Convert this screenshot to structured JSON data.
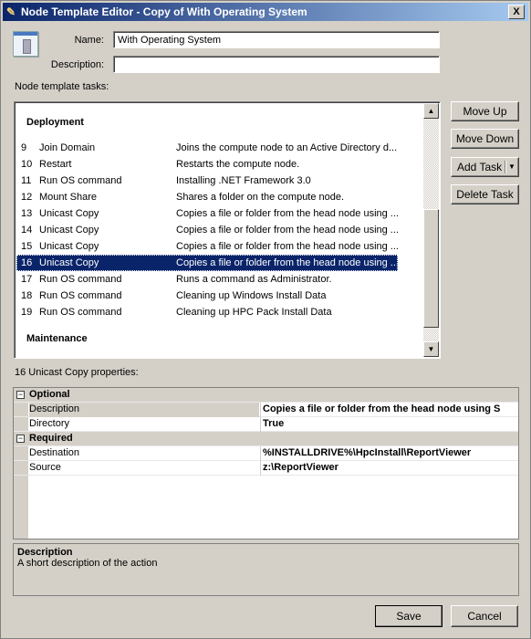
{
  "window": {
    "title": "Node Template Editor - Copy of With Operating System",
    "close_label": "X"
  },
  "form": {
    "name_label": "Name:",
    "name_value": "With Operating System",
    "description_label": "Description:",
    "description_value": ""
  },
  "tasks": {
    "label": "Node template tasks:",
    "groups": [
      "Deployment",
      "Maintenance"
    ],
    "rows": [
      {
        "num": "9",
        "name": "Join Domain",
        "desc": "Joins the compute node to an Active Directory d..."
      },
      {
        "num": "10",
        "name": "Restart",
        "desc": "Restarts the compute node."
      },
      {
        "num": "11",
        "name": "Run OS command",
        "desc": "Installing .NET Framework 3.0"
      },
      {
        "num": "12",
        "name": "Mount Share",
        "desc": "Shares a folder on the compute node."
      },
      {
        "num": "13",
        "name": "Unicast Copy",
        "desc": "Copies a file or folder from the head node using ..."
      },
      {
        "num": "14",
        "name": "Unicast Copy",
        "desc": "Copies a file or folder from the head node using ..."
      },
      {
        "num": "15",
        "name": "Unicast Copy",
        "desc": "Copies a file or folder from the head node using ..."
      },
      {
        "num": "16",
        "name": "Unicast Copy",
        "desc": "Copies a file or folder from the head node using ...",
        "selected": true
      },
      {
        "num": "17",
        "name": "Run OS command",
        "desc": "Runs a command as Administrator."
      },
      {
        "num": "18",
        "name": "Run OS command",
        "desc": "Cleaning up Windows Install Data"
      },
      {
        "num": "19",
        "name": "Run OS command",
        "desc": "Cleaning up HPC Pack Install Data"
      }
    ]
  },
  "buttons": {
    "move_up": "Move Up",
    "move_down": "Move Down",
    "add_task": "Add Task",
    "delete_task": "Delete Task",
    "save": "Save",
    "cancel": "Cancel"
  },
  "properties": {
    "label": "16 Unicast Copy properties:",
    "categories": [
      {
        "name": "Optional",
        "items": [
          {
            "key": "Description",
            "value": "Copies a file or folder from the head node using S",
            "selected": true
          },
          {
            "key": "Directory",
            "value": "True"
          }
        ]
      },
      {
        "name": "Required",
        "items": [
          {
            "key": "Destination",
            "value": "%INSTALLDRIVE%\\HpcInstall\\ReportViewer"
          },
          {
            "key": "Source",
            "value": "z:\\ReportViewer"
          }
        ]
      }
    ]
  },
  "help": {
    "title": "Description",
    "text": "A short description of the action"
  }
}
